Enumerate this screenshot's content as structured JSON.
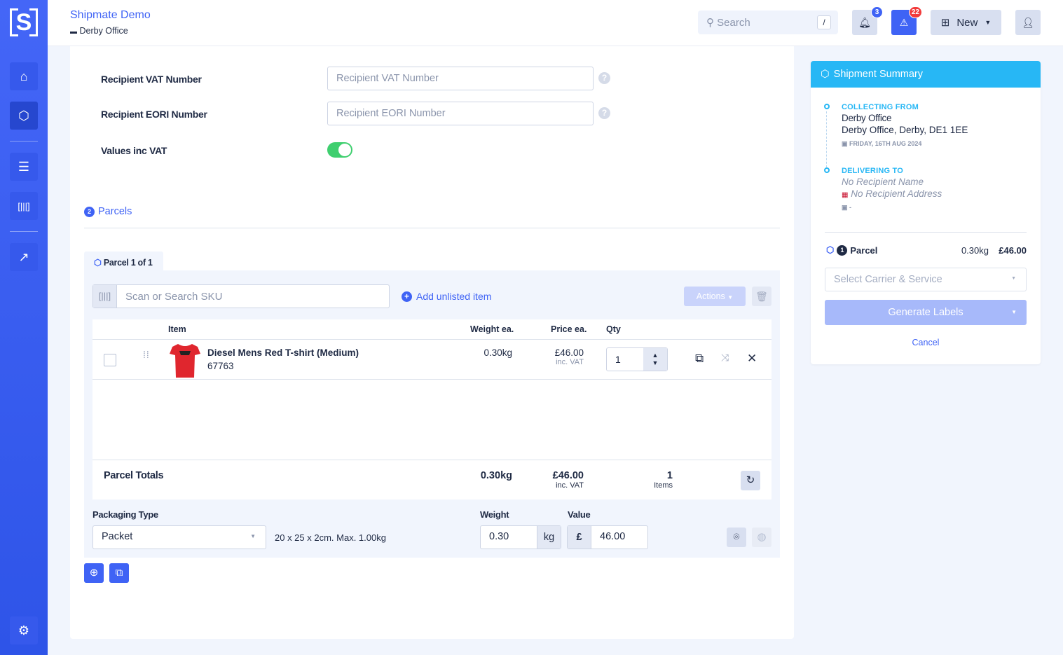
{
  "header": {
    "app_title": "Shipmate Demo",
    "location": "Derby Office",
    "search_placeholder": "Search",
    "search_shortcut": "/",
    "notifications_count": "3",
    "alerts_count": "22",
    "new_label": "New"
  },
  "sidebar": {
    "logo": "S",
    "items": [
      "home",
      "shipments",
      "contacts",
      "barcode",
      "analytics",
      "settings"
    ]
  },
  "form": {
    "vat_label": "Recipient VAT Number",
    "vat_placeholder": "Recipient VAT Number",
    "eori_label": "Recipient EORI Number",
    "eori_placeholder": "Recipient EORI Number",
    "values_inc_vat_label": "Values inc VAT",
    "values_inc_vat": true
  },
  "parcels": {
    "section_number": "2",
    "section_title": "Parcels",
    "tab_label": "Parcel 1 of 1",
    "sku_placeholder": "Scan or Search SKU",
    "add_unlisted": "Add unlisted item",
    "actions_label": "Actions",
    "columns": [
      "Item",
      "Weight ea.",
      "Price ea.",
      "Qty"
    ],
    "items": [
      {
        "name": "Diesel Mens Red T-shirt (Medium)",
        "sku": "67763",
        "weight": "0.30kg",
        "price": "£46.00",
        "price_note": "inc. VAT",
        "qty": "1"
      }
    ],
    "totals": {
      "label": "Parcel Totals",
      "weight": "0.30kg",
      "value": "£46.00",
      "value_note": "inc. VAT",
      "items": "1",
      "items_label": "Items"
    },
    "packaging_label": "Packaging Type",
    "packaging_value": "Packet",
    "packaging_desc": "20 x 25 x 2cm. Max. 1.00kg",
    "weight_label": "Weight",
    "weight_value": "0.30",
    "weight_unit": "kg",
    "value_label": "Value",
    "currency": "£",
    "value_value": "46.00"
  },
  "summary": {
    "title": "Shipment Summary",
    "collecting_label": "COLLECTING FROM",
    "collecting_name": "Derby Office",
    "collecting_address": "Derby Office, Derby, DE1 1EE",
    "collecting_date": "FRIDAY, 16TH AUG 2024",
    "delivering_label": "DELIVERING TO",
    "recipient_name": "No Recipient Name",
    "recipient_address": "No Recipient Address",
    "delivering_date": "-",
    "parcel_number": "1",
    "parcel_label": "Parcel",
    "parcel_weight": "0.30kg",
    "parcel_value": "£46.00",
    "carrier_placeholder": "Select Carrier & Service",
    "generate_label": "Generate Labels",
    "cancel_label": "Cancel"
  },
  "colors": {
    "primary": "#3f63f5",
    "summary_header": "#27b7f5",
    "toggle_on": "#3fcf6f",
    "alert_badge": "#f23b3b"
  }
}
